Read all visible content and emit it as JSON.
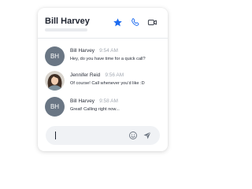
{
  "header": {
    "contact_name": "Bill Harvey",
    "icons": [
      "star-icon",
      "phone-icon",
      "video-camera-icon"
    ]
  },
  "messages": [
    {
      "sender": "Bill Harvey",
      "time": "9:54 AM",
      "text": "Hey, do you have time for a quick call?",
      "avatar": {
        "type": "initials",
        "initials": "BH"
      }
    },
    {
      "sender": "Jennifer Reid",
      "time": "9:56 AM",
      "text": "Of course! Call whenever you'd like :D",
      "avatar": {
        "type": "photo"
      }
    },
    {
      "sender": "Bill Harvey",
      "time": "9:58 AM",
      "text": "Great! Calling right now...",
      "avatar": {
        "type": "initials",
        "initials": "BH"
      }
    }
  ],
  "composer": {
    "value": "",
    "icons": [
      "emoji-icon",
      "send-icon"
    ]
  },
  "colors": {
    "accent": "#1e6cf0",
    "avatar_bg": "#6a7684",
    "input_bg": "#f0f2f5"
  }
}
